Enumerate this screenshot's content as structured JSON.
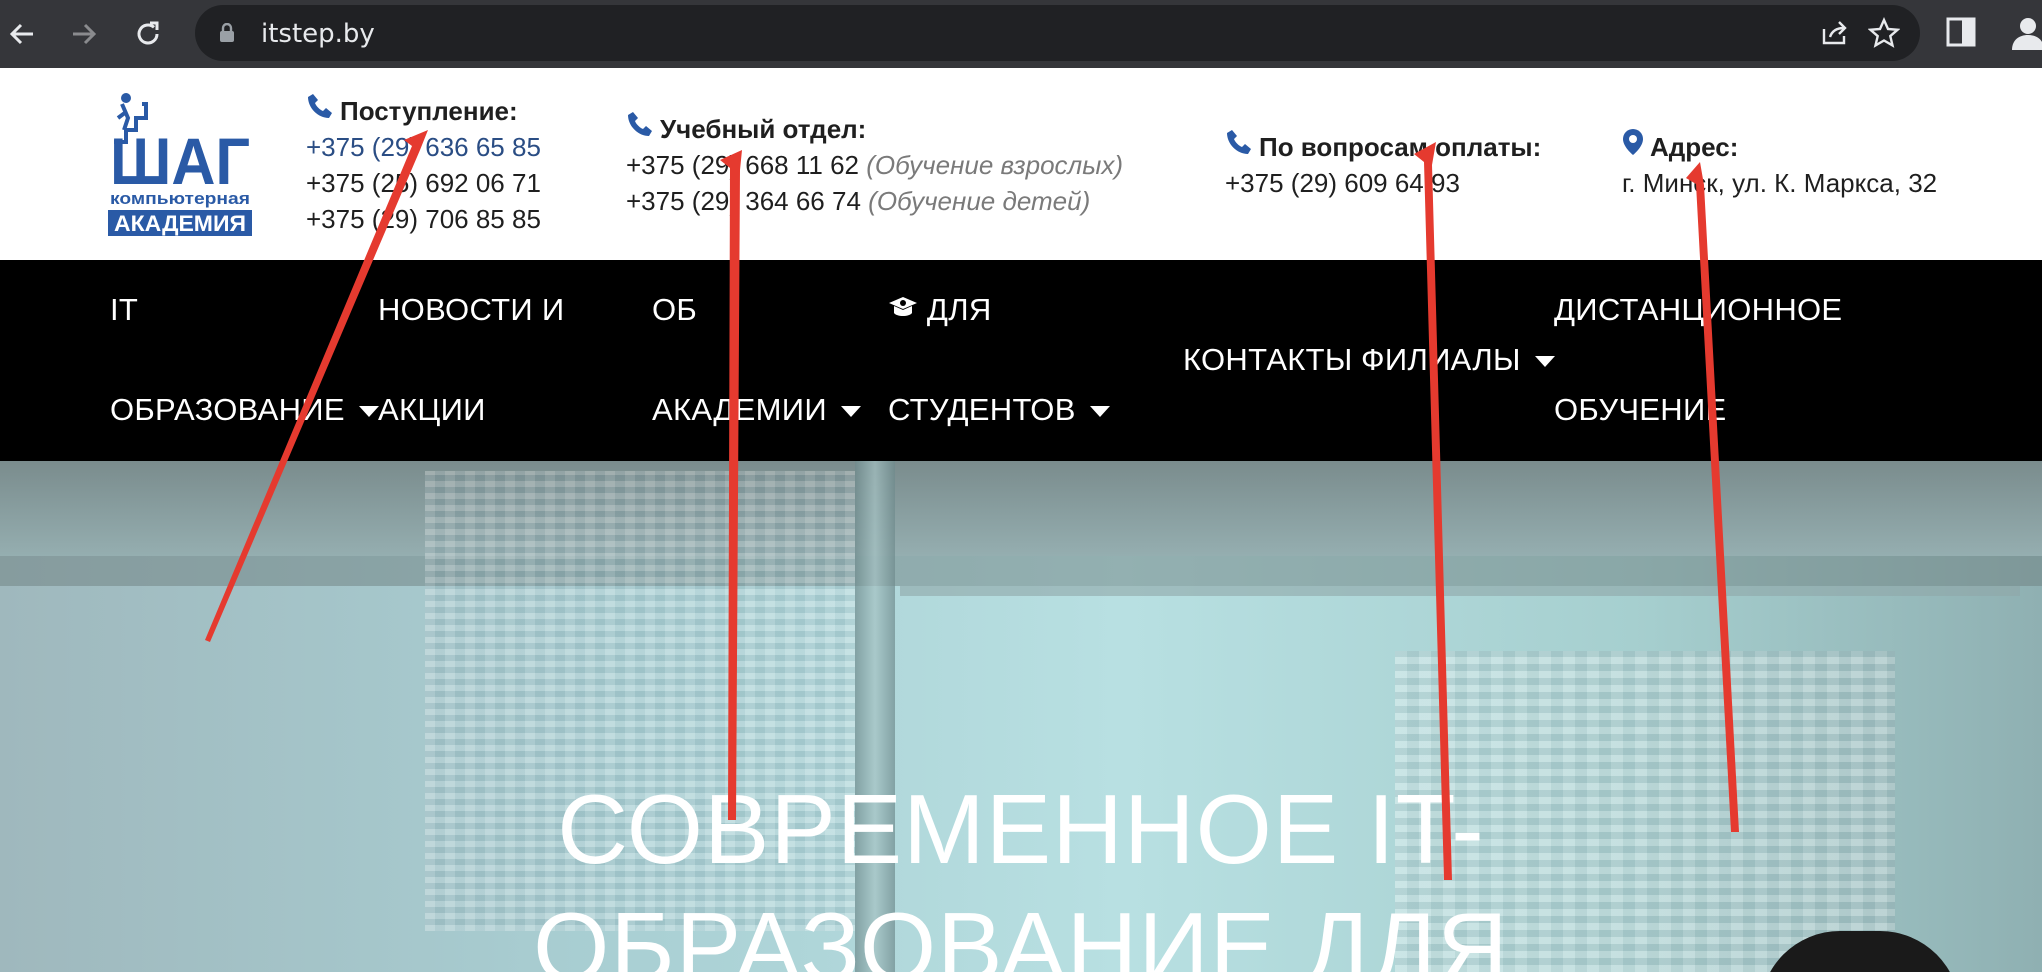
{
  "browser": {
    "url": "itstep.by",
    "icons": [
      "back-icon",
      "forward-icon",
      "reload-icon",
      "lock-icon",
      "share-icon",
      "star-icon",
      "side-panel-icon",
      "profile-icon"
    ]
  },
  "logo": {
    "line1": "ШАГ",
    "line2": "компьютерная",
    "line3": "АКАДЕМИЯ",
    "color": "#2a5aa6"
  },
  "contacts": {
    "admission": {
      "title": "Поступление:",
      "phones": [
        "+375 (29) 636 65 85",
        "+375 (25) 692 06 71",
        "+375 (29) 706 85 85"
      ]
    },
    "study": {
      "title": "Учебный отдел:",
      "rows": [
        {
          "phone": "+375 (29) 668 11 62",
          "note": "(Обучение взрослых)"
        },
        {
          "phone": "+375 (29) 364 66 74",
          "note": "(Обучение детей)"
        }
      ]
    },
    "payment": {
      "title": "По вопросам оплаты:",
      "phone": "+375 (29) 609 64 93"
    },
    "address": {
      "title": "Адрес:",
      "value": "г. Минск, ул. К. Маркса, 32"
    }
  },
  "nav": {
    "it_line1": "IT",
    "it_line2": "ОБРАЗОВАНИЕ",
    "news_line1": "НОВОСТИ И",
    "news_line2": "АКЦИИ",
    "about_line1": "ОБ",
    "about_line2": "АКАДЕМИИ",
    "students_line1": "ДЛЯ",
    "students_line2": "СТУДЕНТОВ",
    "contacts": "КОНТАКТЫ",
    "branches": "ФИЛИАЛЫ",
    "distance_line1": "ДИСТАНЦИОННОЕ",
    "distance_line2": "ОБУЧЕНИЕ"
  },
  "hero": {
    "line1": "СОВРЕМЕННОЕ IT-",
    "line2": "ОБРАЗОВАНИЕ ДЛЯ"
  },
  "colors": {
    "accent_blue": "#2a4d84",
    "nav_bg": "#000000",
    "annotation_red": "#e53a2f"
  }
}
